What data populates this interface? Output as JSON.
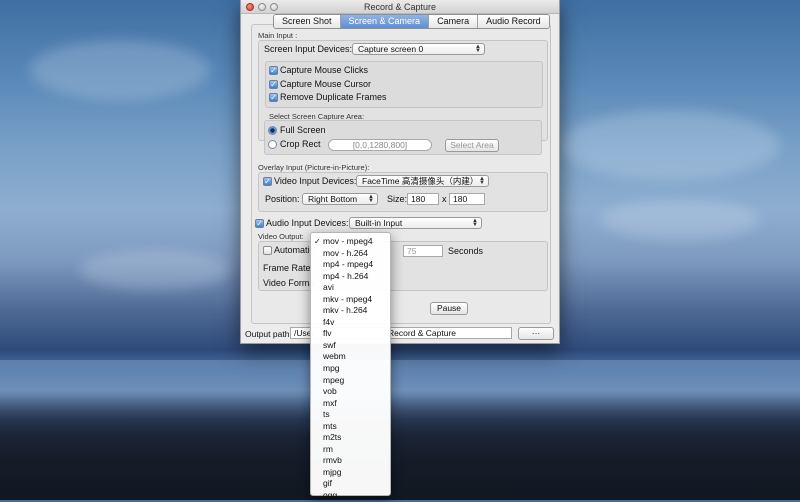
{
  "window": {
    "title": "Record & Capture",
    "tabs": [
      {
        "label": "Screen Shot",
        "active": false
      },
      {
        "label": "Screen & Camera",
        "active": true
      },
      {
        "label": "Camera",
        "active": false
      },
      {
        "label": "Audio Record",
        "active": false
      }
    ]
  },
  "main_input": {
    "section_label": "Main Input :",
    "devices_label": "Screen Input Devices:",
    "devices_value": "Capture screen 0",
    "options": [
      {
        "label": "Capture Mouse Clicks",
        "checked": true
      },
      {
        "label": "Capture Mouse Cursor",
        "checked": true
      },
      {
        "label": "Remove Duplicate Frames",
        "checked": true
      }
    ],
    "area_label": "Select Screen Capture Area:",
    "full_screen_label": "Full Screen",
    "full_screen_selected": true,
    "crop_label": "Crop Rect",
    "crop_value": "[0,0,1280,800]",
    "select_area_button": "Select Area"
  },
  "overlay": {
    "section_label": "Overlay Input (Picture-in-Picture):",
    "video_checkbox_label": "Video Input Devices:",
    "video_checked": true,
    "video_device": "FaceTime 高清摄像头（内建）",
    "position_label": "Position:",
    "position_value": "Right Bottom",
    "size_label": "Size:",
    "size_w": "180",
    "size_x": "x",
    "size_h": "180"
  },
  "audio": {
    "checkbox_label": "Audio Input Devices:",
    "checked": true,
    "device": "Built-in Input"
  },
  "video_output": {
    "section_label": "Video Output:",
    "automatic_label": "Automatic",
    "automatic_checked": false,
    "seconds_value": "75",
    "seconds_label": "Seconds",
    "frame_rate_label": "Frame Rate:",
    "video_format_label": "Video Forma"
  },
  "controls": {
    "pause_button": "Pause"
  },
  "output": {
    "label": "Output path:",
    "path_prefix": "/User",
    "path_suffix": "Record & Capture",
    "browse_button": "···"
  },
  "format_menu": {
    "selected": "mov - mpeg4",
    "items": [
      "mov - mpeg4",
      "mov - h.264",
      "mp4 - mpeg4",
      "mp4 - h.264",
      "avi",
      "mkv - mpeg4",
      "mkv - h.264",
      "f4v",
      "flv",
      "swf",
      "webm",
      "mpg",
      "mpeg",
      "vob",
      "mxf",
      "ts",
      "mts",
      "m2ts",
      "rm",
      "rmvb",
      "mjpg",
      "gif",
      "ogg"
    ]
  },
  "icons": {
    "check": "✓",
    "updown": "▲▼"
  }
}
